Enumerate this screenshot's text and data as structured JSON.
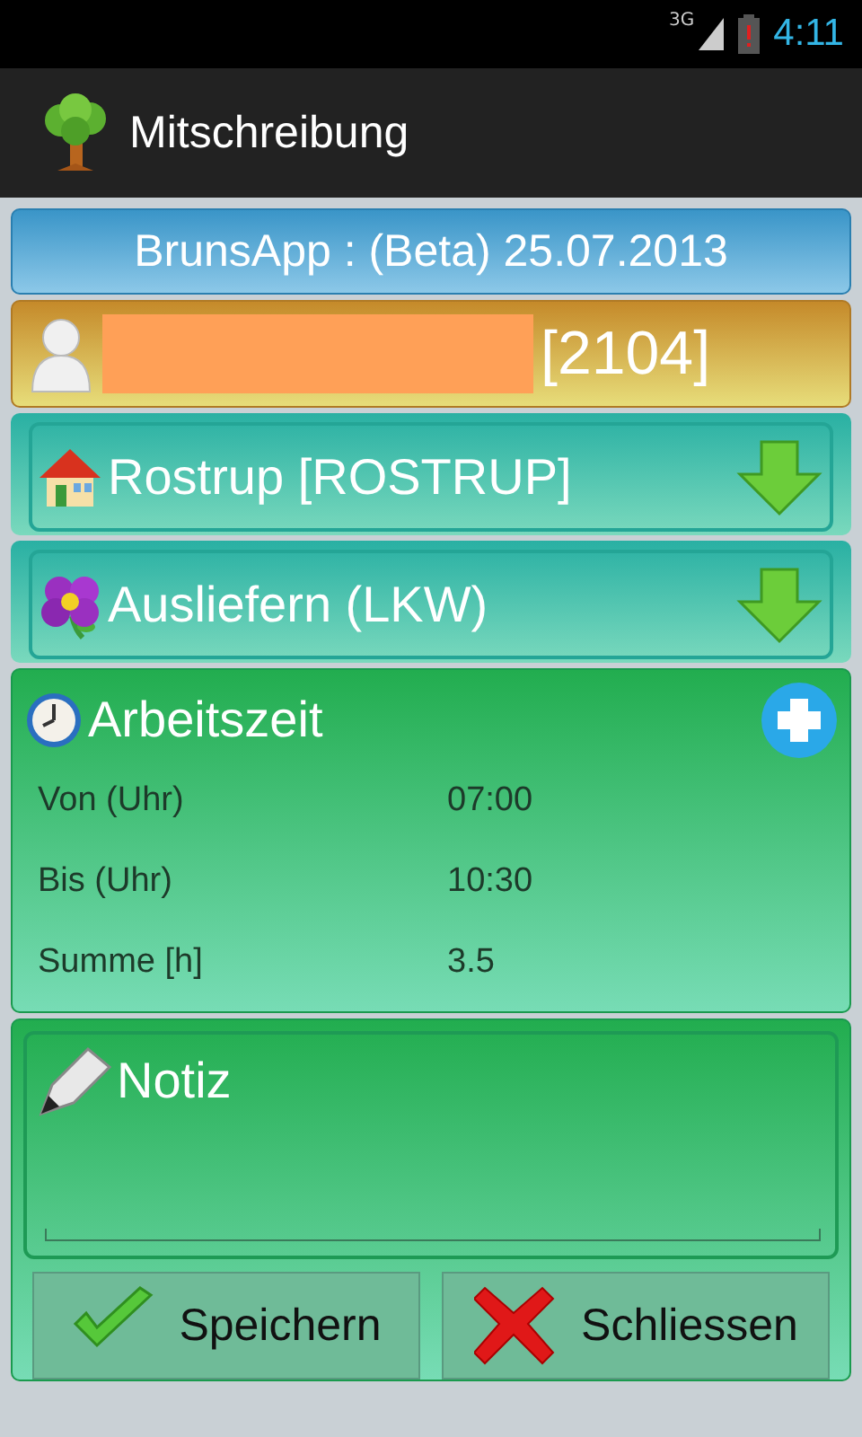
{
  "status_bar": {
    "network": "3G",
    "time": "4:11"
  },
  "app_bar": {
    "title": "Mitschreibung"
  },
  "header": {
    "text": "BrunsApp : (Beta) 25.07.2013"
  },
  "user": {
    "id": "[2104]"
  },
  "selectors": [
    {
      "kind": "location",
      "label": "Rostrup [ROSTRUP]"
    },
    {
      "kind": "activity",
      "label": "Ausliefern (LKW)"
    }
  ],
  "work_time": {
    "title": "Arbeitszeit",
    "rows": [
      {
        "label": "Von (Uhr)",
        "value": "07:00"
      },
      {
        "label": "Bis (Uhr)",
        "value": "10:30"
      },
      {
        "label": "Summe [h]",
        "value": "3.5"
      }
    ]
  },
  "note": {
    "title": "Notiz"
  },
  "buttons": [
    {
      "kind": "save",
      "label": "Speichern"
    },
    {
      "kind": "close",
      "label": "Schliessen"
    }
  ]
}
